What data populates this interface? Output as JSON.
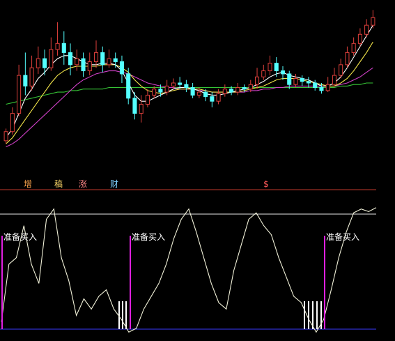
{
  "colors": {
    "background": "#000000",
    "up_candle": "#e0403c",
    "down_candle": "#54ffff",
    "ma_fast": "#ffffff",
    "ma_mid": "#f2e44a",
    "ma_slow": "#d040c8",
    "ma_long": "#36c436",
    "panel_divider": "#c0392b",
    "oscillator": "#f0f0d8",
    "upper_band": "#e8e8e8",
    "baseline": "#3a3aff",
    "signal_bar": "#e020e0",
    "volume_tick": "#ffffff"
  },
  "tags": [
    {
      "text": "增",
      "color": "#f4a04a"
    },
    {
      "text": "稿",
      "color": "#f6d266"
    },
    {
      "text": "涨",
      "color": "#f08080"
    },
    {
      "text": "财",
      "color": "#7fd0ff"
    },
    {
      "text": "$",
      "color": "#ff5a5a"
    }
  ],
  "signals": [
    {
      "text": "准备买入",
      "color": "#ffffff"
    },
    {
      "text": "准备买入",
      "color": "#ffffff"
    },
    {
      "text": "准备买入",
      "color": "#ffffff"
    }
  ],
  "chart_data": [
    {
      "type": "candlestick",
      "panel": "price",
      "ylim": [
        0,
        100
      ],
      "candles": [
        {
          "o": 12,
          "c": 18,
          "h": 20,
          "l": 10
        },
        {
          "o": 18,
          "c": 30,
          "h": 34,
          "l": 16
        },
        {
          "o": 30,
          "c": 55,
          "h": 62,
          "l": 28
        },
        {
          "o": 55,
          "c": 48,
          "h": 70,
          "l": 42
        },
        {
          "o": 48,
          "c": 60,
          "h": 68,
          "l": 45
        },
        {
          "o": 60,
          "c": 66,
          "h": 74,
          "l": 56
        },
        {
          "o": 66,
          "c": 60,
          "h": 72,
          "l": 55
        },
        {
          "o": 60,
          "c": 72,
          "h": 80,
          "l": 58
        },
        {
          "o": 72,
          "c": 76,
          "h": 90,
          "l": 68
        },
        {
          "o": 76,
          "c": 70,
          "h": 84,
          "l": 62
        },
        {
          "o": 70,
          "c": 62,
          "h": 76,
          "l": 55
        },
        {
          "o": 62,
          "c": 66,
          "h": 72,
          "l": 58
        },
        {
          "o": 66,
          "c": 58,
          "h": 70,
          "l": 54
        },
        {
          "o": 58,
          "c": 64,
          "h": 70,
          "l": 55
        },
        {
          "o": 64,
          "c": 70,
          "h": 78,
          "l": 60
        },
        {
          "o": 70,
          "c": 62,
          "h": 74,
          "l": 57
        },
        {
          "o": 62,
          "c": 66,
          "h": 72,
          "l": 60
        },
        {
          "o": 66,
          "c": 64,
          "h": 70,
          "l": 60
        },
        {
          "o": 64,
          "c": 56,
          "h": 68,
          "l": 50
        },
        {
          "o": 56,
          "c": 40,
          "h": 60,
          "l": 36
        },
        {
          "o": 40,
          "c": 30,
          "h": 44,
          "l": 26
        },
        {
          "o": 30,
          "c": 36,
          "h": 42,
          "l": 24
        },
        {
          "o": 36,
          "c": 42,
          "h": 46,
          "l": 34
        },
        {
          "o": 42,
          "c": 46,
          "h": 48,
          "l": 40
        },
        {
          "o": 46,
          "c": 44,
          "h": 49,
          "l": 41
        },
        {
          "o": 44,
          "c": 48,
          "h": 52,
          "l": 42
        },
        {
          "o": 48,
          "c": 50,
          "h": 53,
          "l": 46
        },
        {
          "o": 50,
          "c": 49,
          "h": 54,
          "l": 46
        },
        {
          "o": 49,
          "c": 47,
          "h": 52,
          "l": 44
        },
        {
          "o": 47,
          "c": 42,
          "h": 50,
          "l": 40
        },
        {
          "o": 42,
          "c": 44,
          "h": 47,
          "l": 40
        },
        {
          "o": 44,
          "c": 41,
          "h": 46,
          "l": 38
        },
        {
          "o": 41,
          "c": 38,
          "h": 44,
          "l": 34
        },
        {
          "o": 38,
          "c": 43,
          "h": 46,
          "l": 36
        },
        {
          "o": 43,
          "c": 46,
          "h": 49,
          "l": 41
        },
        {
          "o": 46,
          "c": 44,
          "h": 48,
          "l": 42
        },
        {
          "o": 44,
          "c": 47,
          "h": 50,
          "l": 42
        },
        {
          "o": 47,
          "c": 46,
          "h": 49,
          "l": 44
        },
        {
          "o": 46,
          "c": 49,
          "h": 52,
          "l": 44
        },
        {
          "o": 49,
          "c": 54,
          "h": 60,
          "l": 46
        },
        {
          "o": 54,
          "c": 58,
          "h": 62,
          "l": 52
        },
        {
          "o": 58,
          "c": 63,
          "h": 68,
          "l": 55
        },
        {
          "o": 63,
          "c": 58,
          "h": 67,
          "l": 54
        },
        {
          "o": 58,
          "c": 56,
          "h": 61,
          "l": 52
        },
        {
          "o": 56,
          "c": 49,
          "h": 58,
          "l": 46
        },
        {
          "o": 49,
          "c": 53,
          "h": 56,
          "l": 47
        },
        {
          "o": 53,
          "c": 51,
          "h": 55,
          "l": 48
        },
        {
          "o": 51,
          "c": 50,
          "h": 54,
          "l": 47
        },
        {
          "o": 50,
          "c": 47,
          "h": 52,
          "l": 45
        },
        {
          "o": 47,
          "c": 45,
          "h": 50,
          "l": 43
        },
        {
          "o": 45,
          "c": 49,
          "h": 54,
          "l": 44
        },
        {
          "o": 49,
          "c": 55,
          "h": 60,
          "l": 48
        },
        {
          "o": 55,
          "c": 62,
          "h": 66,
          "l": 53
        },
        {
          "o": 62,
          "c": 70,
          "h": 74,
          "l": 60
        },
        {
          "o": 70,
          "c": 76,
          "h": 80,
          "l": 68
        },
        {
          "o": 76,
          "c": 82,
          "h": 86,
          "l": 74
        },
        {
          "o": 82,
          "c": 88,
          "h": 92,
          "l": 80
        },
        {
          "o": 88,
          "c": 93,
          "h": 98,
          "l": 86
        }
      ],
      "ma_fast": [
        14,
        20,
        30,
        40,
        46,
        53,
        57,
        62,
        66,
        68,
        68,
        66,
        64,
        62,
        62,
        63,
        63,
        62,
        58,
        50,
        42,
        38,
        38,
        40,
        42,
        44,
        46,
        47,
        47,
        46,
        45,
        43,
        42,
        42,
        43,
        44,
        45,
        46,
        47,
        49,
        51,
        54,
        56,
        57,
        55,
        54,
        53,
        52,
        50,
        48,
        48,
        50,
        54,
        60,
        67,
        74,
        81,
        88
      ],
      "ma_mid": [
        10,
        14,
        20,
        26,
        32,
        38,
        44,
        50,
        55,
        58,
        60,
        61,
        61,
        61,
        61,
        62,
        62,
        62,
        60,
        57,
        52,
        48,
        45,
        44,
        43,
        44,
        45,
        46,
        46,
        46,
        46,
        45,
        44,
        44,
        44,
        44,
        44,
        45,
        46,
        47,
        48,
        50,
        52,
        53,
        53,
        53,
        52,
        51,
        50,
        49,
        48,
        48,
        50,
        53,
        58,
        64,
        70,
        77
      ],
      "ma_slow": [
        8,
        10,
        13,
        17,
        21,
        25,
        29,
        33,
        37,
        41,
        45,
        49,
        52,
        54,
        56,
        57,
        58,
        58,
        57,
        56,
        54,
        52,
        50,
        49,
        48,
        47,
        47,
        46,
        46,
        46,
        45,
        45,
        44,
        44,
        44,
        44,
        44,
        44,
        45,
        45,
        46,
        46,
        47,
        47,
        48,
        48,
        48,
        48,
        48,
        48,
        48,
        48,
        49,
        50,
        52,
        54,
        57,
        60
      ],
      "ma_long": [
        36,
        37,
        38,
        39,
        40,
        41,
        42,
        43,
        44,
        44,
        45,
        45,
        46,
        46,
        46,
        46,
        47,
        47,
        47,
        47,
        47,
        47,
        47,
        47,
        47,
        47,
        47,
        47,
        47,
        47,
        47,
        47,
        47,
        47,
        47,
        47,
        47,
        47,
        47,
        47,
        47,
        47,
        47,
        47,
        47,
        47,
        47,
        47,
        47,
        47,
        47,
        47,
        48,
        48,
        49,
        49,
        50,
        50
      ]
    },
    {
      "type": "line",
      "panel": "oscillator",
      "ylim": [
        0,
        100
      ],
      "values": [
        10,
        55,
        60,
        85,
        55,
        40,
        90,
        98,
        60,
        42,
        15,
        28,
        20,
        30,
        35,
        20,
        12,
        2,
        5,
        20,
        30,
        40,
        55,
        75,
        90,
        98,
        80,
        60,
        40,
        25,
        20,
        50,
        70,
        90,
        95,
        85,
        78,
        60,
        45,
        30,
        25,
        12,
        2,
        12,
        35,
        60,
        80,
        95,
        98,
        96,
        99
      ]
    }
  ]
}
